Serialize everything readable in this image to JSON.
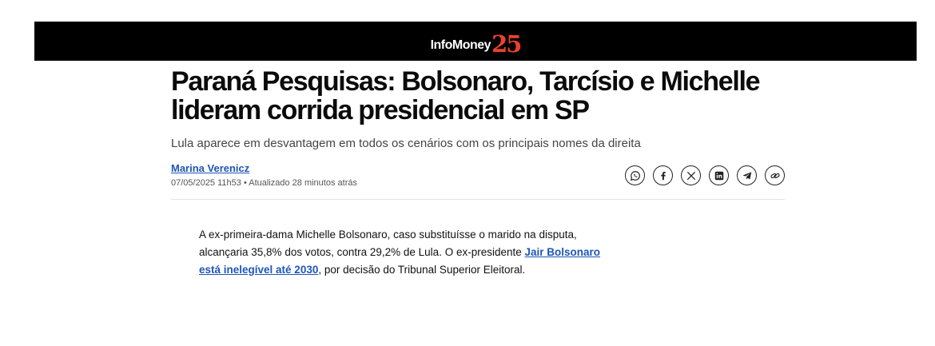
{
  "header": {
    "logo_text": "InfoMoney",
    "logo_number": "25"
  },
  "article": {
    "headline": "Paraná Pesquisas: Bolsonaro, Tarcísio e Michelle lideram corrida presidencial em SP",
    "subtitle": "Lula aparece em desvantagem em todos os cenários com os principais nomes da direita",
    "author": "Marina Verenicz",
    "meta": "07/05/2025 11h53 • Atualizado 28 minutos atrás",
    "share_icons": [
      "whatsapp-icon",
      "facebook-icon",
      "x-icon",
      "linkedin-icon",
      "telegram-icon",
      "copy-link-icon"
    ],
    "body": {
      "text_1": "A ex-primeira-dama Michelle Bolsonaro, caso substituísse o marido na disputa, alcançaria 35,8% dos votos, contra 29,2% de Lula. O ex-presidente ",
      "link": "Jair Bolsonaro está inelegível até 2030",
      "text_2": ", por decisão do Tribunal Superior Eleitoral."
    }
  },
  "colors": {
    "topbar": "#000000",
    "logo_accent": "#e8432d",
    "link": "#1e56b8"
  }
}
